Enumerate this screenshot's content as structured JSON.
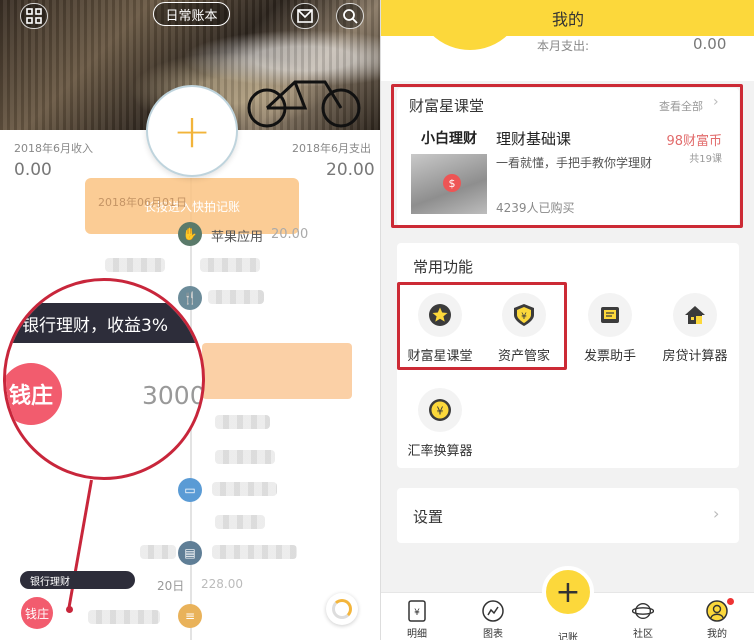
{
  "left": {
    "header": {
      "book_label": "日常账本"
    },
    "stats": {
      "income_label": "2018年6月收入",
      "income_value": "0.00",
      "expense_label": "2018年6月支出",
      "expense_value": "20.00"
    },
    "hint": {
      "text": "长按进入快拍记账",
      "date": "2018年06月01日"
    },
    "timeline": [
      {
        "label": "苹果应用",
        "amount": "20.00"
      }
    ],
    "zoom": {
      "banner": "银行理财，收益3%",
      "badge": "钱庄",
      "amount": "3000"
    },
    "bottom": {
      "tooltip": "银行理财",
      "badge": "钱庄",
      "date": "20日",
      "amount": "228.00"
    }
  },
  "right": {
    "header": {
      "title": "我的"
    },
    "summary": {
      "month_label": "本月支出:",
      "month_value": "0.00"
    },
    "course_section": {
      "title": "财富星课堂",
      "view_all": "查看全部",
      "thumb_title": "小白理财",
      "course": {
        "name": "理财基础课",
        "desc": "一看就懂，手把手教你学理财",
        "buyers": "4239人已购买",
        "price": "98财富币",
        "lessons": "共19课"
      }
    },
    "functions": {
      "title": "常用功能",
      "items": [
        {
          "label": "财富星课堂",
          "icon": "star-icon"
        },
        {
          "label": "资产管家",
          "icon": "shield-yen-icon"
        },
        {
          "label": "发票助手",
          "icon": "receipt-icon"
        },
        {
          "label": "房贷计算器",
          "icon": "house-icon"
        },
        {
          "label": "汇率换算器",
          "icon": "yen-coin-icon"
        }
      ]
    },
    "settings": {
      "label": "设置"
    },
    "nav": {
      "items": [
        {
          "label": "明细"
        },
        {
          "label": "图表"
        },
        {
          "label": "记账"
        },
        {
          "label": "社区"
        },
        {
          "label": "我的"
        }
      ]
    },
    "colors": {
      "accent": "#fcd83b",
      "highlight": "#cc2a35",
      "price": "#e26c6c"
    }
  }
}
